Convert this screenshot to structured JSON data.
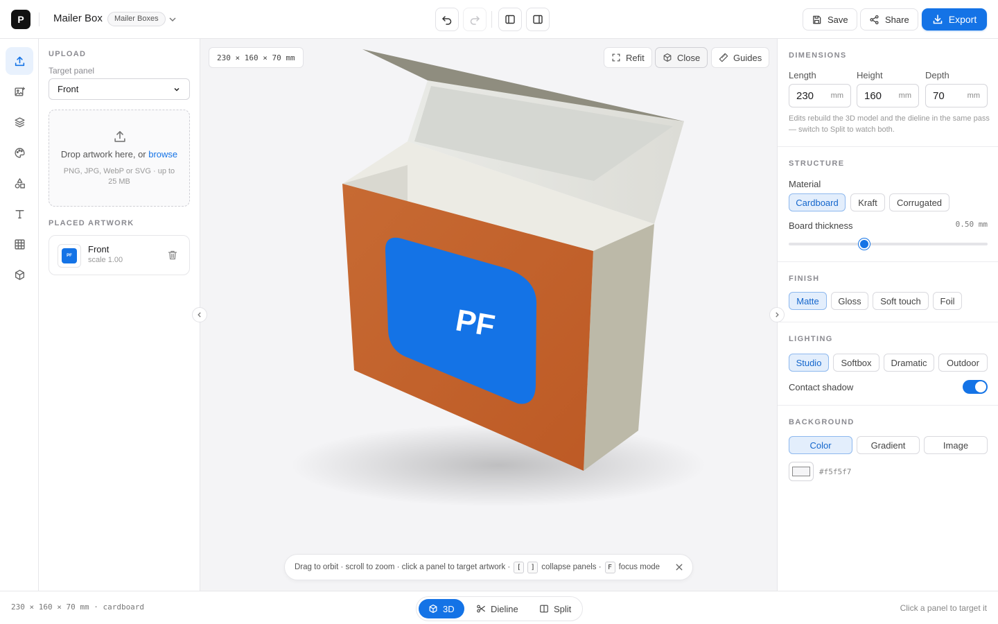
{
  "header": {
    "logo_letter": "P",
    "project_title": "Mailer Box",
    "project_badge": "Mailer Boxes",
    "save_label": "Save",
    "share_label": "Share",
    "export_label": "Export"
  },
  "rail": {
    "items": [
      "upload-icon",
      "image-add-icon",
      "layers-icon",
      "palette-icon",
      "shapes-icon",
      "text-icon",
      "grid-icon",
      "box-icon"
    ],
    "active": "upload-icon"
  },
  "left_panel": {
    "upload_heading": "UPLOAD",
    "target_label": "Target panel",
    "target_value": "Front",
    "drop_text": "Drop artwork here, or ",
    "drop_link": "browse",
    "drop_sub": "PNG, JPG, WebP or SVG · up to 25 MB",
    "placed_heading": "PLACED ARTWORK",
    "artwork": {
      "thumb_text": "PF",
      "name": "Front",
      "scale": "scale 1.00"
    }
  },
  "viewport": {
    "dimension_chip": "230 × 160 × 70 mm",
    "refit_label": "Refit",
    "close_label": "Close",
    "guides_label": "Guides",
    "front_art_text": "PF",
    "colors": {
      "front_panel": "#c2602a",
      "artwork": "#1473e6",
      "side_panel": "#bcb9a8",
      "interior": "#ecebe4",
      "lid_inner": "#8f8d7f",
      "background": "#f4f4f6"
    },
    "hint": {
      "text1": "Drag to orbit · scroll to zoom · click a panel to target artwork ·",
      "key1": "[",
      "key2": "]",
      "text2": "collapse panels ·",
      "key3": "F",
      "text3": "focus mode"
    }
  },
  "right_panel": {
    "dimensions": {
      "heading": "DIMENSIONS",
      "length_label": "Length",
      "length_value": "230",
      "height_label": "Height",
      "height_value": "160",
      "depth_label": "Depth",
      "depth_value": "70",
      "unit": "mm",
      "note": "Edits rebuild the 3D model and the dieline in the same pass — switch to Split to watch both."
    },
    "structure": {
      "heading": "STRUCTURE",
      "material_label": "Material",
      "materials": [
        "Cardboard",
        "Kraft",
        "Corrugated"
      ],
      "selected_material": "Cardboard",
      "thickness_label": "Board thickness",
      "thickness_value": "0.50 mm",
      "thickness_fraction": 0.38
    },
    "finish": {
      "heading": "FINISH",
      "options": [
        "Matte",
        "Gloss",
        "Soft touch",
        "Foil"
      ],
      "selected": "Matte"
    },
    "lighting": {
      "heading": "LIGHTING",
      "options": [
        "Studio",
        "Softbox",
        "Dramatic",
        "Outdoor"
      ],
      "selected": "Studio",
      "shadow_label": "Contact shadow",
      "shadow_on": true
    },
    "background": {
      "heading": "BACKGROUND",
      "options": [
        "Color",
        "Gradient",
        "Image"
      ],
      "selected": "Color",
      "hex": "#f5f5f7"
    }
  },
  "statusbar": {
    "left": "230 × 160 × 70 mm · cardboard",
    "right": "Click a panel to target it",
    "modes": [
      "3D",
      "Dieline",
      "Split"
    ],
    "active_mode": "3D"
  },
  "accent_color": "#1473e6"
}
